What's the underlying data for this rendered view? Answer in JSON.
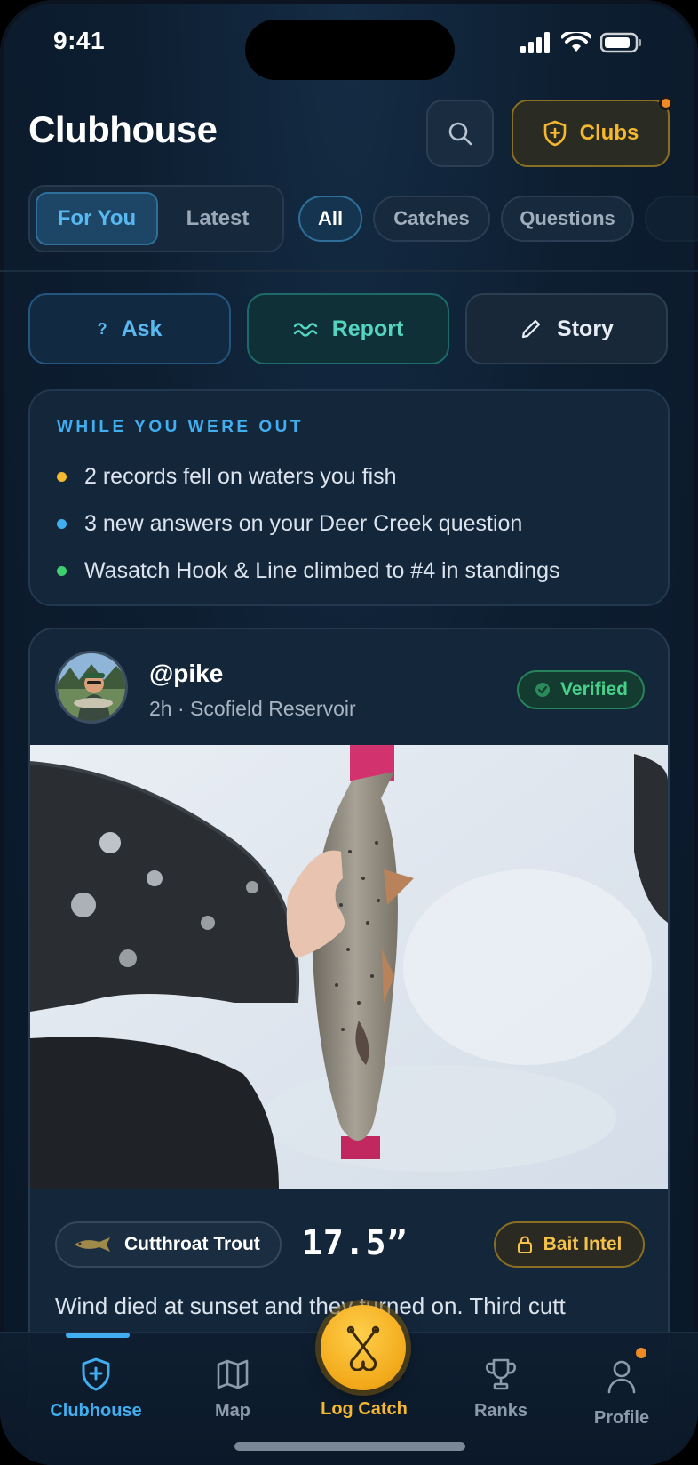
{
  "status_bar": {
    "time": "9:41"
  },
  "header": {
    "title": "Clubhouse",
    "clubs_label": "Clubs"
  },
  "feed_tabs": [
    {
      "label": "For You",
      "active": true
    },
    {
      "label": "Latest",
      "active": false
    }
  ],
  "filters": [
    {
      "label": "All",
      "active": true
    },
    {
      "label": "Catches",
      "active": false
    },
    {
      "label": "Questions",
      "active": false
    }
  ],
  "actions": {
    "ask": "Ask",
    "report": "Report",
    "story": "Story"
  },
  "while_you_were_out": {
    "title": "WHILE YOU WERE OUT",
    "items": [
      {
        "text": "2 records fell on waters you fish",
        "color": "#f5b82e"
      },
      {
        "text": "3 new answers on your Deer Creek question",
        "color": "#41aef0"
      },
      {
        "text": "Wasatch Hook & Line climbed to #4 in standings",
        "color": "#3ed070"
      }
    ]
  },
  "post": {
    "username": "@pike",
    "meta": "2h · Scofield Reservoir",
    "verified_label": "Verified",
    "species": "Cutthroat Trout",
    "length": "17.5”",
    "bait_label": "Bait Intel",
    "caption": "Wind died at sunset and they turned on. Third cutt"
  },
  "tabbar": {
    "items": [
      {
        "label": "Clubhouse",
        "icon": "shield-plus-icon",
        "active": true
      },
      {
        "label": "Map",
        "icon": "map-icon",
        "active": false
      },
      {
        "label": "Log Catch",
        "icon": "hooks-icon",
        "active": false
      },
      {
        "label": "Ranks",
        "icon": "trophy-icon",
        "active": false
      },
      {
        "label": "Profile",
        "icon": "person-icon",
        "active": false
      }
    ]
  },
  "colors": {
    "accent_blue": "#41aef0",
    "accent_gold": "#f5b82e",
    "accent_teal": "#55d4c0",
    "verified_green": "#46d08a",
    "background": "#0d1e31"
  }
}
